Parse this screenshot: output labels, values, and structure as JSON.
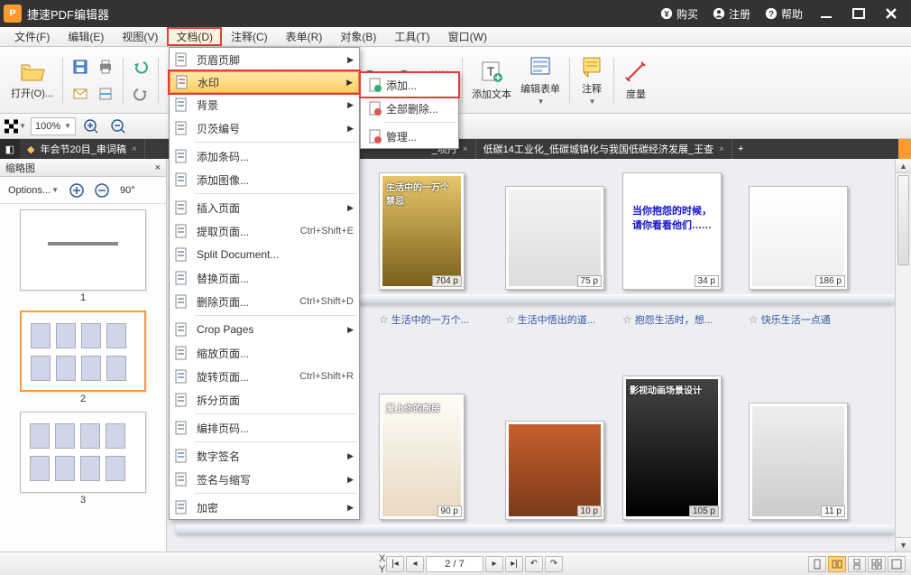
{
  "title": "捷速PDF编辑器",
  "titlebar": {
    "buy": "购买",
    "register": "注册",
    "help": "帮助"
  },
  "menubar": [
    "文件(F)",
    "编辑(E)",
    "视图(V)",
    "文档(D)",
    "注释(C)",
    "表单(R)",
    "对象(B)",
    "工具(T)",
    "窗口(W)"
  ],
  "menubar_active": 3,
  "toolbar": {
    "open": "打开(O)...",
    "addtext": "添加文本",
    "editform": "编辑表单",
    "annotate": "注释",
    "measure": "度量"
  },
  "zoom": "100%",
  "tabs": [
    "年会节20目_串词稿",
    "_项丹",
    "低碳14工业化_低碳城镇化与我国低碳经济发展_王查"
  ],
  "sidebar": {
    "title": "缩略图",
    "options": "Options...",
    "rotate": "90°"
  },
  "thumbs": [
    {
      "num": "1",
      "selected": false
    },
    {
      "num": "2",
      "selected": true
    },
    {
      "num": "3",
      "selected": false
    }
  ],
  "dropdown": {
    "items": [
      {
        "label": "页眉页脚",
        "sub": true
      },
      {
        "label": "水印",
        "sub": true,
        "hl": true,
        "boxed": true
      },
      {
        "label": "背景",
        "sub": true
      },
      {
        "label": "贝茨编号",
        "sub": true
      },
      {
        "sep": true
      },
      {
        "label": "添加条码...",
        "sub": false
      },
      {
        "label": "添加图像...",
        "sub": false
      },
      {
        "sep": true
      },
      {
        "label": "插入页面",
        "sub": true
      },
      {
        "label": "提取页面...",
        "shortcut": "Ctrl+Shift+E"
      },
      {
        "label": "Split Document..."
      },
      {
        "label": "替换页面..."
      },
      {
        "label": "删除页面...",
        "shortcut": "Ctrl+Shift+D"
      },
      {
        "sep": true
      },
      {
        "label": "Crop Pages",
        "sub": true
      },
      {
        "label": "缩放页面..."
      },
      {
        "label": "旋转页面...",
        "shortcut": "Ctrl+Shift+R"
      },
      {
        "label": "拆分页面"
      },
      {
        "sep": true
      },
      {
        "label": "编排页码..."
      },
      {
        "sep": true
      },
      {
        "label": "数字签名",
        "sub": true
      },
      {
        "label": "签名与缩写",
        "sub": true
      },
      {
        "sep": true
      },
      {
        "label": "加密",
        "sub": true
      }
    ]
  },
  "submenu": {
    "items": [
      {
        "label": "添加...",
        "boxed": true
      },
      {
        "label": "全部删除..."
      },
      {
        "sep": true
      },
      {
        "label": "管理..."
      }
    ]
  },
  "canvas": {
    "books": [
      {
        "pages": "704 p",
        "cap": "生活中的一万个...",
        "title": "生活中的一万个禁忌",
        "color1": "#e8c66b",
        "color2": "#7a5f1a"
      },
      {
        "pages": "75 p",
        "cap": "生活中悟出的道...",
        "color1": "#f2f2f2",
        "color2": "#ddd"
      },
      {
        "pages": "34 p",
        "cap": "抱怨生活时，想...",
        "text1": "当你抱怨的时候，",
        "text2": "请你看看他们……",
        "color1": "#fff",
        "color2": "#fff"
      },
      {
        "pages": "186 p",
        "cap": "快乐生活一点通",
        "color1": "#fff",
        "color2": "#eee"
      },
      {
        "pages": "90 p",
        "title": "爱上你的厨房",
        "color1": "#fefcf5",
        "color2": "#e8d9c2"
      },
      {
        "pages": "10 p",
        "color1": "#c7602e",
        "color2": "#7a3a18"
      },
      {
        "pages": "105 p",
        "title": "影视动画场景设计",
        "color1": "#444",
        "color2": "#000"
      },
      {
        "pages": "11 p",
        "color1": "#eee",
        "color2": "#ccc"
      }
    ]
  },
  "status": {
    "x": "X :",
    "y": "Y :",
    "page": "2 / 7"
  }
}
